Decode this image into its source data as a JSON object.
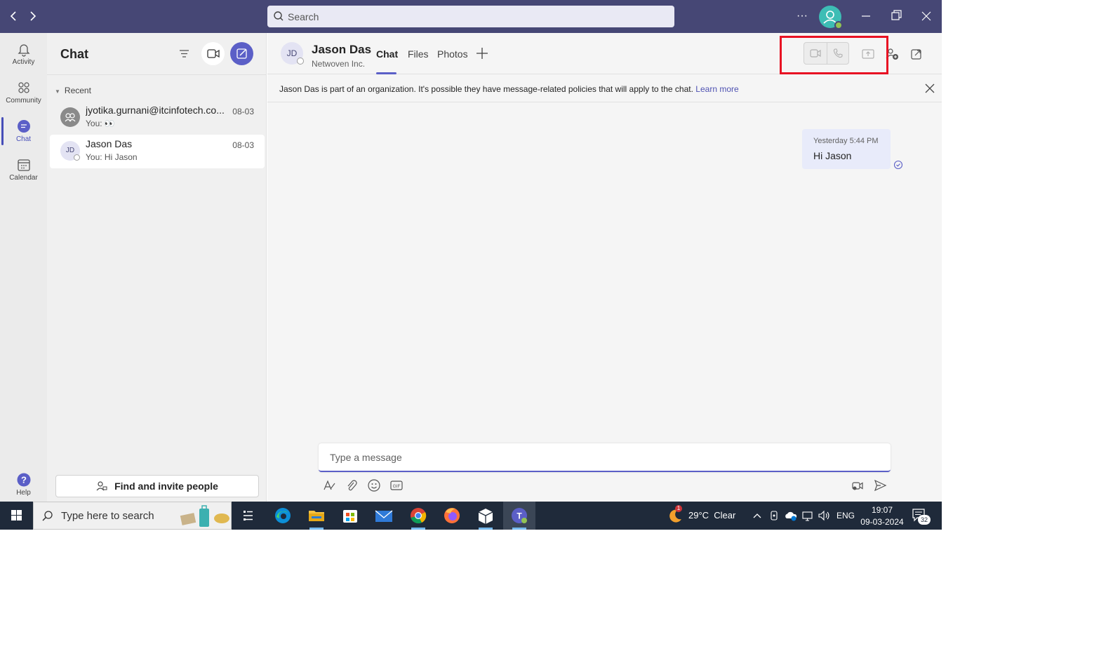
{
  "titlebar": {
    "search_placeholder": "Search",
    "more_label": "···"
  },
  "appbar": {
    "items": [
      {
        "label": "Activity",
        "icon": "bell-icon"
      },
      {
        "label": "Community",
        "icon": "community-icon"
      },
      {
        "label": "Chat",
        "icon": "chat-icon",
        "active": true
      },
      {
        "label": "Calendar",
        "icon": "calendar-icon"
      }
    ],
    "help_label": "Help"
  },
  "chatlist": {
    "title": "Chat",
    "section": "Recent",
    "chats": [
      {
        "name": "jyotika.gurnani@itcinfotech.co...",
        "preview": "You: 👀",
        "date": "08-03",
        "avatar": "group-icon"
      },
      {
        "name": "Jason Das",
        "preview": "You: Hi Jason",
        "date": "08-03",
        "initials": "JD",
        "selected": true
      }
    ],
    "find_button": "Find and invite people"
  },
  "conversation": {
    "initials": "JD",
    "name": "Jason Das",
    "org": "Netwoven Inc.",
    "tabs": [
      {
        "label": "Chat",
        "active": true
      },
      {
        "label": "Files"
      },
      {
        "label": "Photos"
      }
    ],
    "banner_text": "Jason Das is part of an organization. It's possible they have message-related policies that will apply to the chat.",
    "banner_link": "Learn more",
    "messages": [
      {
        "time": "Yesterday 5:44 PM",
        "text": "Hi Jason",
        "from_me": true
      }
    ],
    "compose_placeholder": "Type a message"
  },
  "taskbar": {
    "search_placeholder": "Type here to search",
    "weather": "29°C  Clear",
    "weather_badge": "1",
    "lang": "ENG",
    "time": "19:07",
    "date": "09-03-2024",
    "notif_count": "32"
  },
  "colors": {
    "titlebar": "#464775",
    "accent": "#5b5fc7",
    "highlight": "#e81123"
  }
}
